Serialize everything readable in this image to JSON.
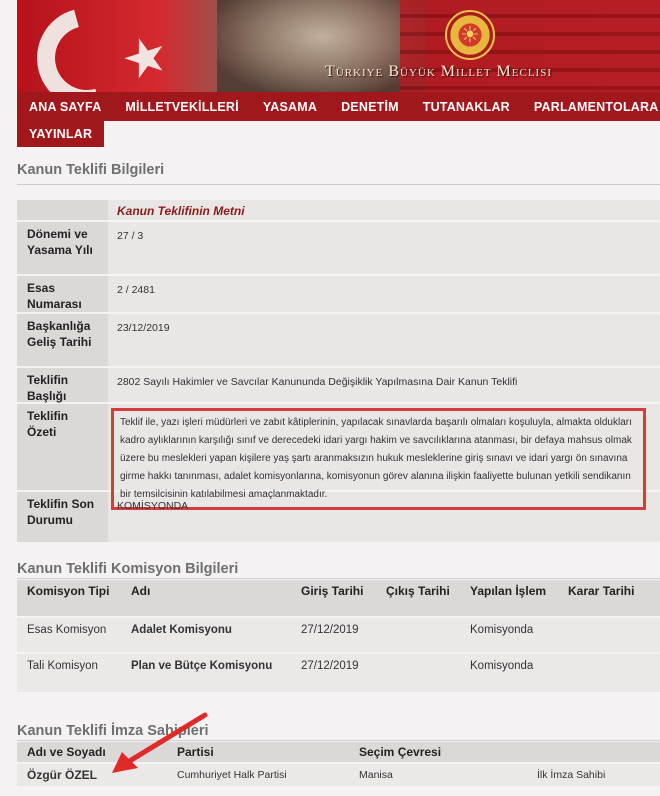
{
  "header": {
    "title": "Türkiye Büyük Millet Meclisi"
  },
  "nav": {
    "items": [
      "ANA SAYFA",
      "MİLLETVEKİLLERİ",
      "YASAMA",
      "DENETİM",
      "TUTANAKLAR",
      "PARLAMENTOLARA"
    ],
    "row2": "YAYINLAR"
  },
  "teklif": {
    "section_title": "Kanun Teklifi Bilgileri",
    "metin_link": "Kanun Teklifinin Metni",
    "rows": [
      {
        "label": "Dönemi ve Yasama Yılı",
        "value": "27 / 3"
      },
      {
        "label": "Esas Numarası",
        "value": "2 / 2481"
      },
      {
        "label": "Başkanlığa Geliş Tarihi",
        "value": "23/12/2019"
      },
      {
        "label": "Teklifin Başlığı",
        "value": "2802 Sayılı Hakimler ve Savcılar Kanununda Değişiklik Yapılmasına Dair Kanun Teklifi"
      },
      {
        "label": "Teklifin Özeti",
        "value": "Teklif ile, yazı işleri müdürleri ve zabıt kâtiplerinin, yapılacak sınavlarda başarılı olmaları koşuluyla, almakta oldukları kadro aylıklarının karşılığı sınıf ve derecedeki idari yargı hakim ve savcılıklarına atanması, bir defaya mahsus olmak üzere bu meslekleri yapan kişilere yaş şartı aranmaksızın hukuk mesleklerine giriş sınavı ve idari yargı ön sınavına girme hakkı tanınması, adalet komisyonlarına, komisyonun görev alanına ilişkin faaliyette bulunan yetkili sendikanın bir temsilcisinin katılabilmesi amaçlanmaktadır."
      },
      {
        "label": "Teklifin Son Durumu",
        "value": "KOMİSYONDA"
      }
    ]
  },
  "komisyon": {
    "section_title": "Kanun Teklifi Komisyon Bilgileri",
    "headers": [
      "Komisyon Tipi",
      "Adı",
      "Giriş Tarihi",
      "Çıkış Tarihi",
      "Yapılan İşlem",
      "Karar Tarihi"
    ],
    "rows": [
      {
        "tip": "Esas Komisyon",
        "adi": "Adalet Komisyonu",
        "giris": "27/12/2019",
        "cikis": "",
        "islem": "Komisyonda",
        "karar": ""
      },
      {
        "tip": "Tali Komisyon",
        "adi": "Plan ve Bütçe Komisyonu",
        "giris": "27/12/2019",
        "cikis": "",
        "islem": "Komisyonda",
        "karar": ""
      }
    ]
  },
  "imza": {
    "section_title": "Kanun Teklifi İmza Sahipleri",
    "headers": [
      "Adı ve Soyadı",
      "Partisi",
      "Seçim Çevresi",
      ""
    ],
    "rows": [
      {
        "ad": "Özgür ÖZEL",
        "parti": "Cumhuriyet Halk Partisi",
        "cevre": "Manisa",
        "rol": "İlk İmza Sahibi"
      }
    ]
  },
  "colors": {
    "nav": "#a0181c",
    "link": "#8b1a1a",
    "highlight": "#d53b3f"
  }
}
